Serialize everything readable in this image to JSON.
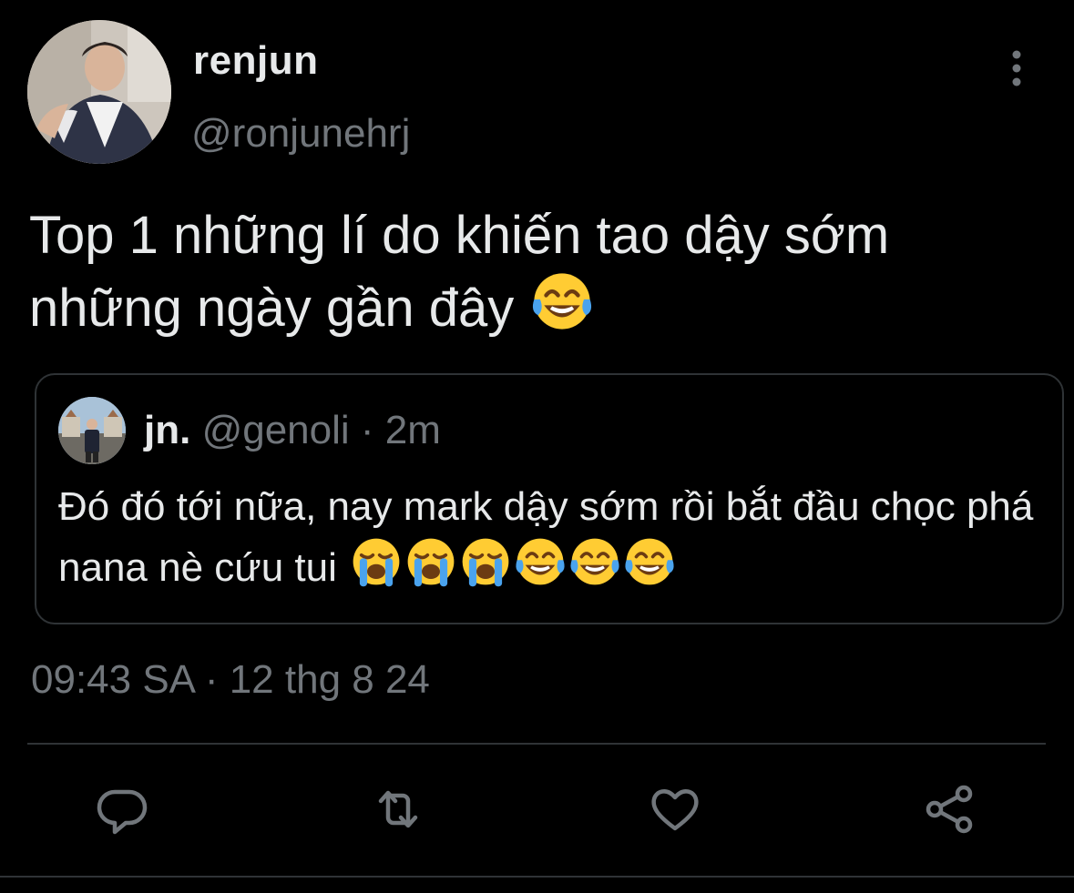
{
  "author": {
    "display_name": "renjun",
    "handle": "@ronjunehrj"
  },
  "tweet": {
    "text": "Top 1 những lí do khiến tao dậy sớm những ngày gần đây",
    "emoji": "face-with-tears-of-joy"
  },
  "quoted_tweet": {
    "display_name": "jn.",
    "handle": "@genoli",
    "separator": "·",
    "time": "2m",
    "text": "Đó đó tới nữa, nay mark dậy sớm rồi bắt đầu chọc phá nana nè cứu tui",
    "emojis": [
      "loudly-crying-face",
      "loudly-crying-face",
      "loudly-crying-face",
      "face-with-tears-of-joy",
      "face-with-tears-of-joy",
      "face-with-tears-of-joy"
    ]
  },
  "timestamp": "09:43 SA · 12 thg 8 24",
  "actions": {
    "icons": [
      "reply-icon",
      "retweet-icon",
      "like-icon",
      "share-icon"
    ]
  },
  "colors": {
    "background": "#000000",
    "text": "#e7e9ea",
    "muted": "#71767b",
    "border": "#2f3336"
  }
}
